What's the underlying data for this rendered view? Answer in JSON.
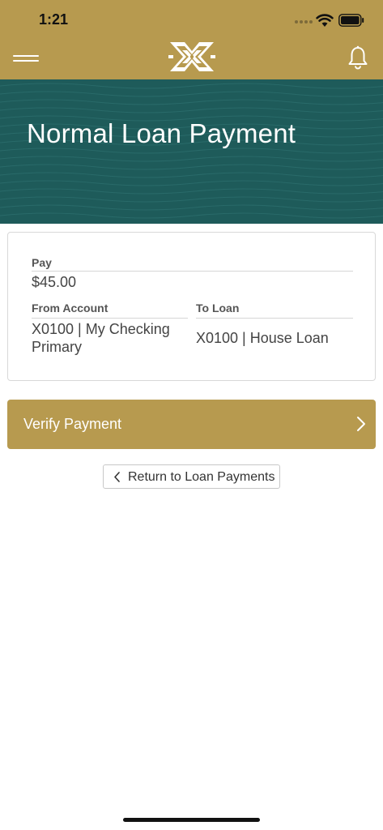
{
  "status_bar": {
    "time": "1:21"
  },
  "icons": {
    "menu": "hamburger-menu-icon",
    "logo": "bank-logo-icon",
    "notifications": "bell-icon",
    "wifi": "wifi-icon",
    "battery": "battery-icon"
  },
  "colors": {
    "brand_gold": "#b79a4f",
    "hero_teal": "#1e5b5a",
    "text_gray": "#444444"
  },
  "page": {
    "title": "Normal Loan Payment"
  },
  "payment": {
    "pay_label": "Pay",
    "pay_value": "$45.00",
    "from_label": "From Account",
    "from_value_line1": "X0100 | My Checking",
    "from_value_line2": "Primary",
    "to_label": "To Loan",
    "to_value": "X0100 | House Loan"
  },
  "actions": {
    "verify_label": "Verify Payment",
    "return_label": "Return to Loan Payments"
  }
}
